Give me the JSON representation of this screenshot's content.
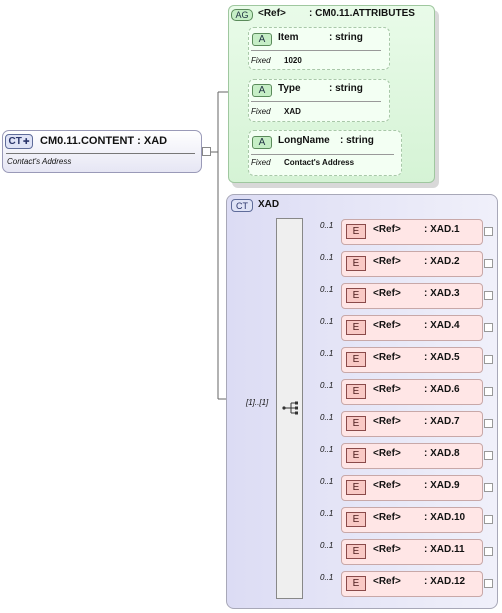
{
  "root": {
    "badge": "CT",
    "name": "CM0.11.CONTENT : XAD",
    "documentation": "Contact's Address"
  },
  "attribute_group": {
    "badge": "AG",
    "ref": "<Ref>",
    "name": ": CM0.11.ATTRIBUTES",
    "attributes": [
      {
        "badge": "A",
        "name": "Item",
        "type": ": string",
        "fixed_label": "Fixed",
        "fixed_value": "1020"
      },
      {
        "badge": "A",
        "name": "Type",
        "type": ": string",
        "fixed_label": "Fixed",
        "fixed_value": "XAD"
      },
      {
        "badge": "A",
        "name": "LongName",
        "type": ": string",
        "fixed_label": "Fixed",
        "fixed_value": "Contact's Address"
      }
    ]
  },
  "complex_type": {
    "badge": "CT",
    "name": "XAD",
    "sequence_cardinality": "[1]..[1]"
  },
  "elements": [
    {
      "badge": "E",
      "ref": "<Ref>",
      "name": ": XAD.1",
      "cardinality": "0..1"
    },
    {
      "badge": "E",
      "ref": "<Ref>",
      "name": ": XAD.2",
      "cardinality": "0..1"
    },
    {
      "badge": "E",
      "ref": "<Ref>",
      "name": ": XAD.3",
      "cardinality": "0..1"
    },
    {
      "badge": "E",
      "ref": "<Ref>",
      "name": ": XAD.4",
      "cardinality": "0..1"
    },
    {
      "badge": "E",
      "ref": "<Ref>",
      "name": ": XAD.5",
      "cardinality": "0..1"
    },
    {
      "badge": "E",
      "ref": "<Ref>",
      "name": ": XAD.6",
      "cardinality": "0..1"
    },
    {
      "badge": "E",
      "ref": "<Ref>",
      "name": ": XAD.7",
      "cardinality": "0..1"
    },
    {
      "badge": "E",
      "ref": "<Ref>",
      "name": ": XAD.8",
      "cardinality": "0..1"
    },
    {
      "badge": "E",
      "ref": "<Ref>",
      "name": ": XAD.9",
      "cardinality": "0..1"
    },
    {
      "badge": "E",
      "ref": "<Ref>",
      "name": ": XAD.10",
      "cardinality": "0..1"
    },
    {
      "badge": "E",
      "ref": "<Ref>",
      "name": ": XAD.11",
      "cardinality": "0..1"
    },
    {
      "badge": "E",
      "ref": "<Ref>",
      "name": ": XAD.12",
      "cardinality": "0..1"
    }
  ]
}
